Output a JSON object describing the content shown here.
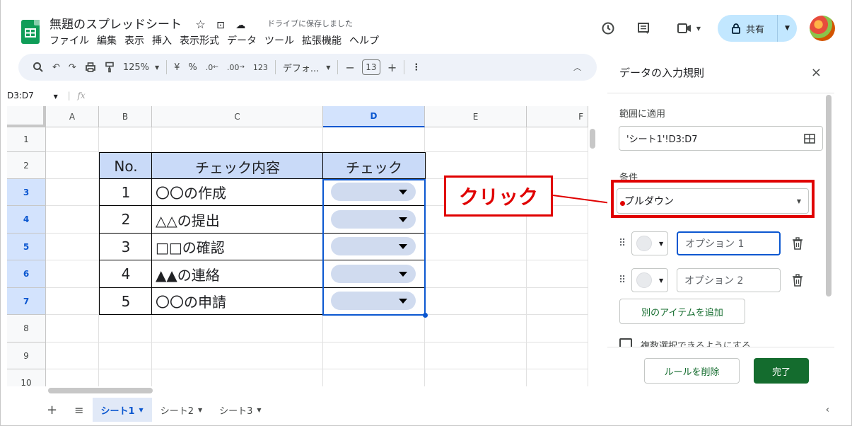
{
  "header": {
    "doc_title": "無題のスプレッドシート",
    "save_status": "ドライブに保存しました",
    "share_label": "共有",
    "menu": [
      "ファイル",
      "編集",
      "表示",
      "挿入",
      "表示形式",
      "データ",
      "ツール",
      "拡張機能",
      "ヘルプ"
    ]
  },
  "toolbar": {
    "zoom": "125%",
    "currency": "¥",
    "percent": "%",
    "dec_decrease": ".0",
    "dec_increase": ".00",
    "number_format": "123",
    "font": "デフォ...",
    "font_size": "13"
  },
  "formula_bar": {
    "name_box": "D3:D7",
    "fx": "fx"
  },
  "grid": {
    "columns": [
      "A",
      "B",
      "C",
      "D",
      "E",
      "F"
    ],
    "rows": [
      "1",
      "2",
      "3",
      "4",
      "5",
      "6",
      "7",
      "8",
      "9",
      "10"
    ],
    "table_header": [
      "No.",
      "チェック内容",
      "チェック"
    ],
    "table_rows": [
      {
        "no": "1",
        "content": "〇〇の作成"
      },
      {
        "no": "2",
        "content": "△△の提出"
      },
      {
        "no": "3",
        "content": "□□の確認"
      },
      {
        "no": "4",
        "content": "▲▲の連絡"
      },
      {
        "no": "5",
        "content": "〇〇の申請"
      }
    ]
  },
  "annotation": {
    "callout": "クリック",
    "color": "#e00000"
  },
  "sheet_tabs": [
    "シート1",
    "シート2",
    "シート3"
  ],
  "panel": {
    "title": "データの入力規則",
    "range_label": "範囲に適用",
    "range_value": "'シート1'!D3:D7",
    "condition_label": "条件",
    "condition_value": "プルダウン",
    "options": [
      "オプション 1",
      "オプション 2"
    ],
    "add_item": "別のアイテムを追加",
    "multi_select": "複数選択できるようにする",
    "delete_rule": "ルールを削除",
    "done": "完了"
  },
  "colors": {
    "accent_green": "#146c2e",
    "selection_blue": "#0b57d0",
    "header_fill": "#c9daf8",
    "chip_fill": "#d0dbef"
  }
}
